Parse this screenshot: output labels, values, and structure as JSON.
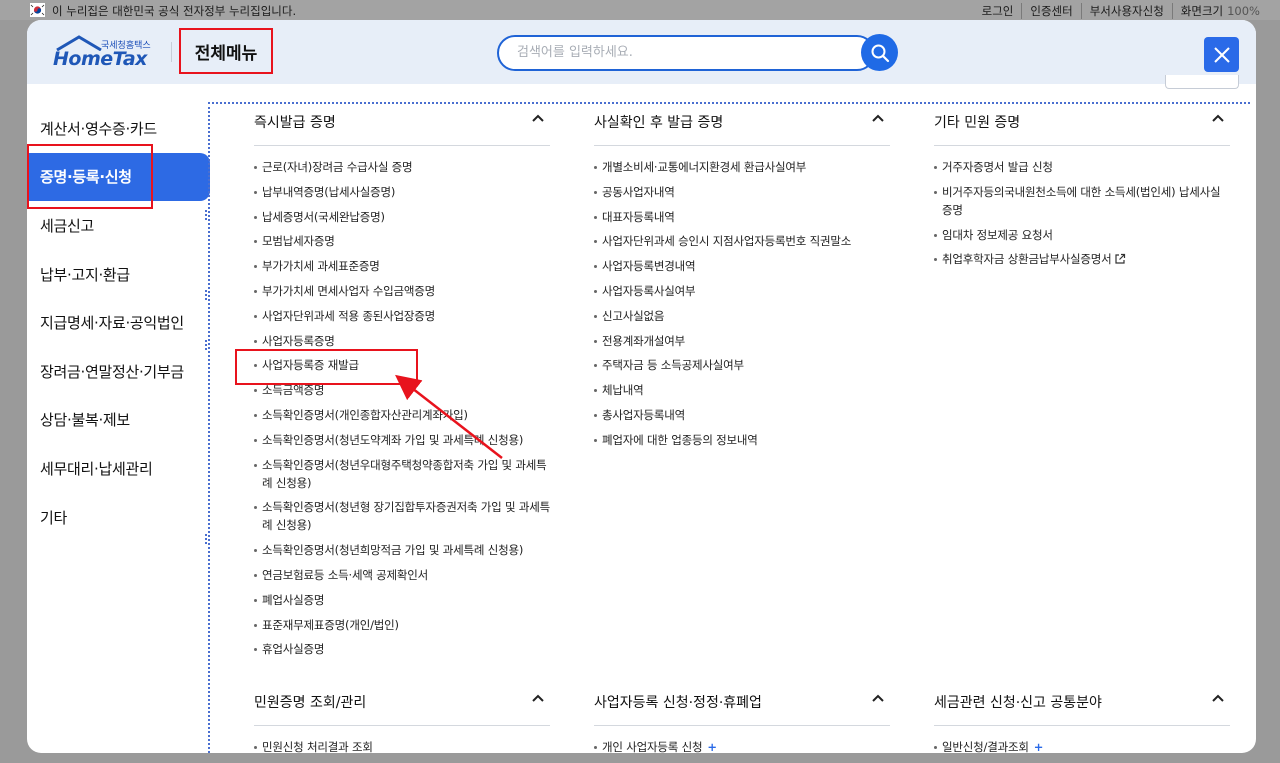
{
  "gov_banner": {
    "text": "이 누리집은 대한민국 공식 전자정부 누리집입니다.",
    "links": [
      "로그인",
      "인증센터",
      "부서사용자신청",
      "화면크기"
    ],
    "zoom": "100%"
  },
  "header": {
    "logo_small": "국세청홈택스",
    "logo_brand": "HomeTax",
    "title": "전체메뉴",
    "search_placeholder": "검색어를 입력하세요."
  },
  "left_nav": [
    {
      "label": "계산서·영수증·카드",
      "active": false
    },
    {
      "label": "증명·등록·신청",
      "active": true
    },
    {
      "label": "세금신고",
      "active": false
    },
    {
      "label": "납부·고지·환급",
      "active": false
    },
    {
      "label": "지급명세·자료·공익법인",
      "active": false
    },
    {
      "label": "장려금·연말정산·기부금",
      "active": false
    },
    {
      "label": "상담·불복·제보",
      "active": false
    },
    {
      "label": "세무대리·납세관리",
      "active": false
    },
    {
      "label": "기타",
      "active": false
    }
  ],
  "sections": [
    {
      "title": "즉시발급 증명",
      "items": [
        "근로(자녀)장려금 수급사실 증명",
        "납부내역증명(납세사실증명)",
        "납세증명서(국세완납증명)",
        "모범납세자증명",
        "부가가치세 과세표준증명",
        "부가가치세 면세사업자 수입금액증명",
        "사업자단위과세 적용 종된사업장증명",
        "사업자등록증명",
        "사업자등록증 재발급",
        "소득금액증명",
        "소득확인증명서(개인종합자산관리계좌가입)",
        "소득확인증명서(청년도약계좌 가입 및 과세특례 신청용)",
        "소득확인증명서(청년우대형주택청약종합저축 가입 및 과세특례 신청용)",
        "소득확인증명서(청년형 장기집합투자증권저축 가입 및 과세특례 신청용)",
        "소득확인증명서(청년희망적금 가입 및 과세특례 신청용)",
        "연금보험료등 소득·세액 공제확인서",
        "폐업사실증명",
        "표준재무제표증명(개인/법인)",
        "휴업사실증명"
      ]
    },
    {
      "title": "사실확인 후 발급 증명",
      "items": [
        "개별소비세·교통에너지환경세 환급사실여부",
        "공동사업자내역",
        "대표자등록내역",
        "사업자단위과세 승인시 지점사업자등록번호 직권말소",
        "사업자등록변경내역",
        "사업자등록사실여부",
        "신고사실없음",
        "전용계좌개설여부",
        "주택자금 등 소득공제사실여부",
        "체납내역",
        "총사업자등록내역",
        "폐업자에 대한 업종등의 정보내역"
      ]
    },
    {
      "title": "기타 민원 증명",
      "items": [
        "거주자증명서 발급 신청",
        "비거주자등의국내원천소득에 대한 소득세(법인세) 납세사실증명",
        "임대차 정보제공 요청서",
        "취업후학자금 상환금납부사실증명서"
      ]
    },
    {
      "title": "민원증명 조회/관리",
      "items": [
        "민원신청 처리결과 조회"
      ]
    },
    {
      "title": "사업자등록 신청·정정·휴폐업",
      "items": [
        "개인 사업자등록 신청"
      ]
    },
    {
      "title": "세금관련 신청·신고 공통분야",
      "items": [
        "일반신청/결과조회"
      ]
    }
  ]
}
